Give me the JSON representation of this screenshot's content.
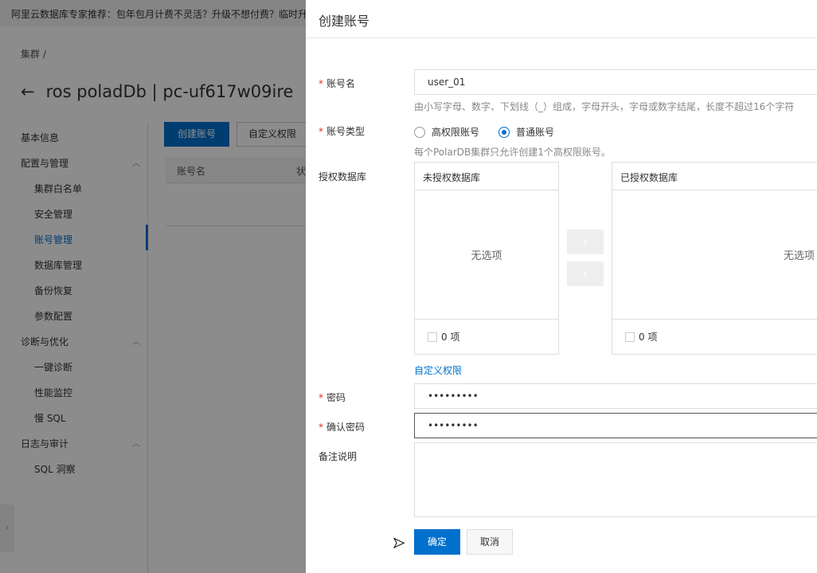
{
  "background": {
    "banner": "阿里云数据库专家推荐：包年包月计费不灵活？升级不想付费？临时升",
    "breadcrumb": "集群",
    "breadcrumb_sep": "/",
    "title": "ros poladDb | pc-uf617w09ire",
    "sidebar": {
      "basic_info": "基本信息",
      "config_group": "配置与管理",
      "config_items": [
        "集群白名单",
        "安全管理",
        "账号管理",
        "数据库管理",
        "备份恢复",
        "参数配置"
      ],
      "diag_group": "诊断与优化",
      "diag_items": [
        "一键诊断",
        "性能监控",
        "慢 SQL"
      ],
      "log_group": "日志与审计",
      "log_items": [
        "SQL 洞察"
      ]
    },
    "create_button": "创建账号",
    "custom_perm_button": "自定义权限",
    "table_headers": [
      "账号名",
      "状"
    ]
  },
  "drawer": {
    "title": "创建账号",
    "account_name": {
      "label": "账号名",
      "value": "user_01",
      "help": "由小写字母、数字、下划线（_）组成，字母开头，字母或数字结尾，长度不超过16个字符"
    },
    "account_type": {
      "label": "账号类型",
      "options": [
        "高权限账号",
        "普通账号"
      ],
      "selected": "普通账号",
      "help": "每个PolarDB集群只允许创建1个高权限账号。"
    },
    "databases": {
      "label": "授权数据库",
      "left_title": "未授权数据库",
      "right_title": "已授权数据库",
      "empty": "无选项",
      "left_count": "0 项",
      "right_count": "0 项"
    },
    "custom_perm_link": "自定义权限",
    "password": {
      "label": "密码",
      "value": "•••••••••"
    },
    "confirm_password": {
      "label": "确认密码",
      "value": "•••••••••"
    },
    "remark": {
      "label": "备注说明",
      "value": ""
    },
    "ok": "确定",
    "cancel": "取消"
  },
  "colors": {
    "primary": "#0070cc",
    "required": "#e0301e"
  }
}
